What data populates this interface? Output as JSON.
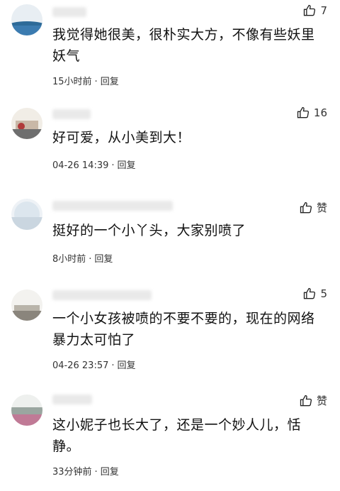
{
  "comments": [
    {
      "text_line1": "我觉得她很美，很朴实大方，不像有些妖里",
      "text_line2": "妖气",
      "likes": "7",
      "time": "15小时前",
      "reply": "回复"
    },
    {
      "text_line1": "好可爱，从小美到大！",
      "likes": "16",
      "time": "04-26 14:39",
      "reply": "回复"
    },
    {
      "text_line1": "挺好的一个小丫头，大家别喷了",
      "likes": "赞",
      "time": "8小时前",
      "reply": "回复"
    },
    {
      "text_line1": "一个小女孩被喷的不要不要的，现在的网络",
      "text_line2": "暴力太可怕了",
      "likes": "5",
      "time": "04-26 23:57",
      "reply": "回复"
    },
    {
      "text_line1": "这小妮子也长大了，还是一个妙人儿，恬",
      "text_line2": "静。",
      "likes": "赞",
      "time": "33分钟前",
      "reply": "回复"
    }
  ],
  "colors": {
    "text": "#111111",
    "meta": "#333333",
    "background": "#ffffff"
  }
}
